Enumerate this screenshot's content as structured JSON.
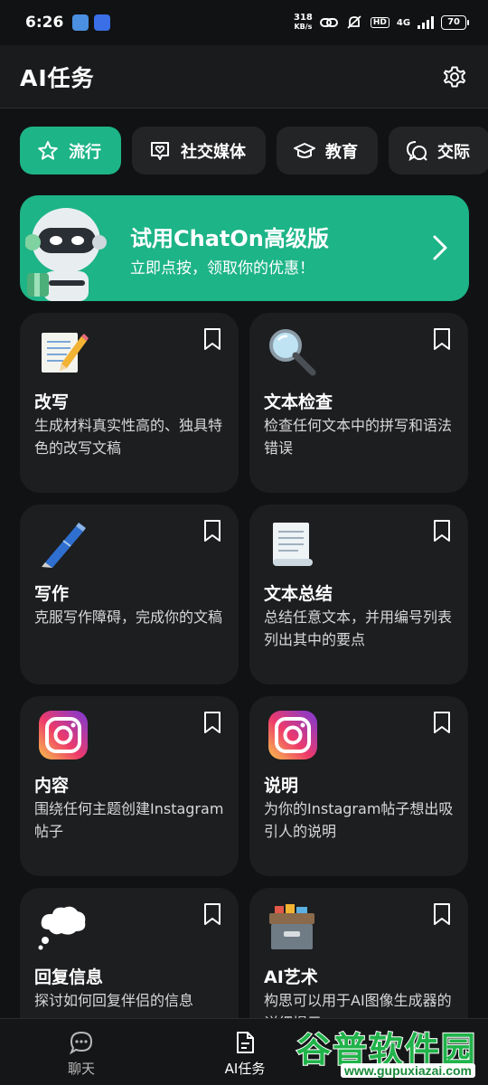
{
  "status_bar": {
    "time": "6:26",
    "net_speed_value": "318",
    "net_speed_unit": "KB/s",
    "hd": "HD",
    "network": "4G",
    "battery": "70"
  },
  "header": {
    "title": "AI任务"
  },
  "tabs": [
    {
      "label": "流行",
      "icon": "star-icon",
      "active": true
    },
    {
      "label": "社交媒体",
      "icon": "heart-chat-icon",
      "active": false
    },
    {
      "label": "教育",
      "icon": "graduation-cap-icon",
      "active": false
    },
    {
      "label": "交际",
      "icon": "chat-bubbles-icon",
      "active": false
    }
  ],
  "promo": {
    "title": "试用ChatOn高级版",
    "subtitle": "立即点按，领取你的优惠！"
  },
  "cards": [
    {
      "title": "改写",
      "desc": "生成材料真实性高的、独具特色的改写文稿",
      "icon": "memo-pencil-icon"
    },
    {
      "title": "文本检查",
      "desc": "检查任何文本中的拼写和语法错误",
      "icon": "magnifier-icon"
    },
    {
      "title": "写作",
      "desc": "克服写作障碍，完成你的文稿",
      "icon": "pen-icon"
    },
    {
      "title": "文本总结",
      "desc": "总结任意文本，并用编号列表列出其中的要点",
      "icon": "scroll-icon"
    },
    {
      "title": "内容",
      "desc": "围绕任何主题创建Instagram帖子",
      "icon": "instagram-icon"
    },
    {
      "title": "说明",
      "desc": "为你的Instagram帖子想出吸引人的说明",
      "icon": "instagram-icon"
    },
    {
      "title": "回复信息",
      "desc": "探讨如何回复伴侣的信息",
      "icon": "thought-bubble-icon"
    },
    {
      "title": "AI艺术",
      "desc": "构思可以用于AI图像生成器的详细提示",
      "icon": "file-cabinet-icon"
    }
  ],
  "bottom_nav": {
    "chat": "聊天",
    "tasks": "AI任务"
  },
  "watermark": {
    "name": "谷普软件园",
    "url": "www.gupuxiazai.com"
  },
  "colors": {
    "accent": "#1db487",
    "background": "#111213",
    "card": "#1d1e20"
  }
}
